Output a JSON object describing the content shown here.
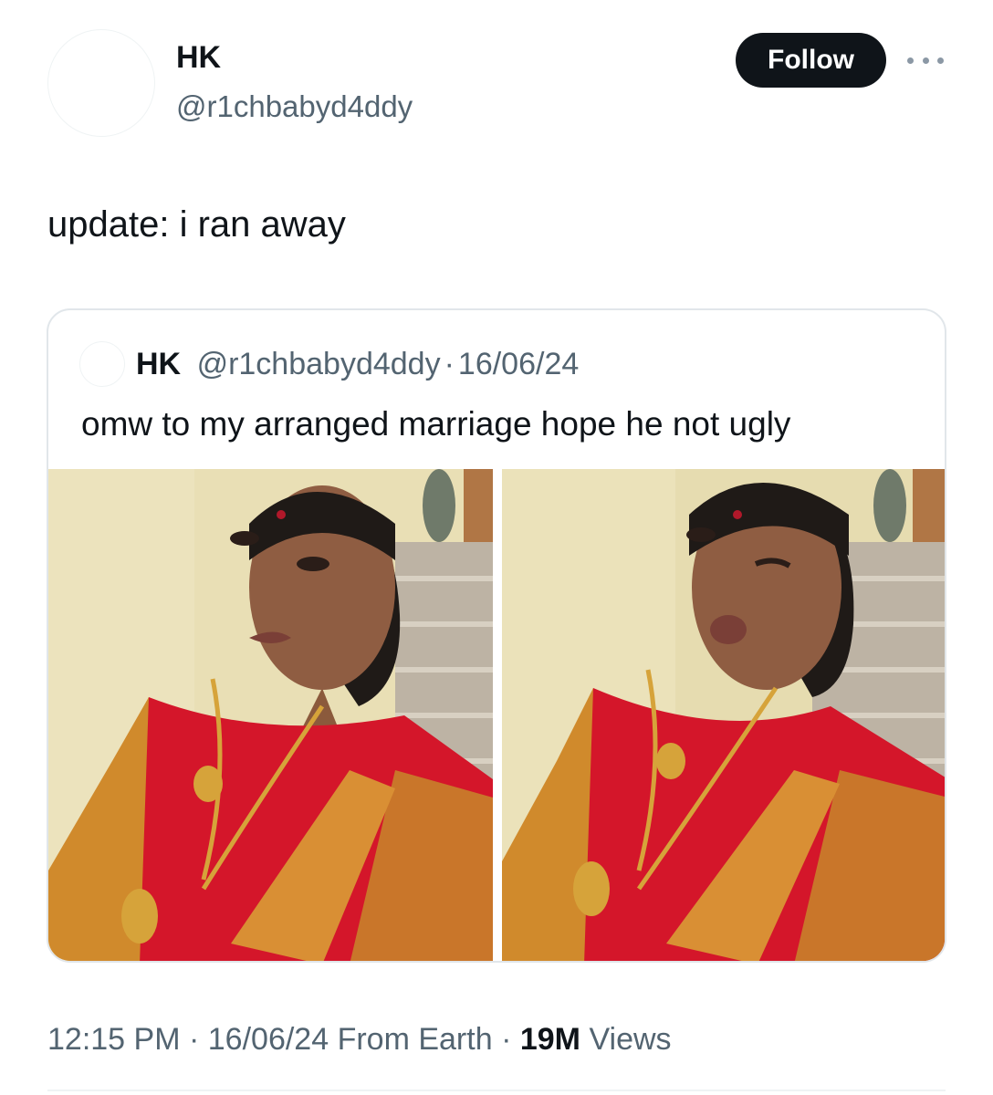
{
  "tweet": {
    "author_name": "HK",
    "author_handle": "@r1chbabyd4ddy",
    "follow_label": "Follow",
    "text": "update: i ran away",
    "time": "12:15 PM",
    "date": "16/06/24",
    "source": "From Earth",
    "views_count": "19M",
    "views_label": "Views",
    "separator": "·"
  },
  "quoted_tweet": {
    "author_name": "HK",
    "author_handle": "@r1chbabyd4ddy",
    "separator": "·",
    "date": "16/06/24",
    "text": "omw to my arranged marriage hope he not ugly"
  },
  "icons": {
    "more": "more-horizontal-icon"
  },
  "colors": {
    "text_primary": "#0f1419",
    "text_secondary": "#536471",
    "follow_bg": "#0f1419",
    "saree_red": "#d4162a",
    "saree_gold": "#d08a2c"
  }
}
